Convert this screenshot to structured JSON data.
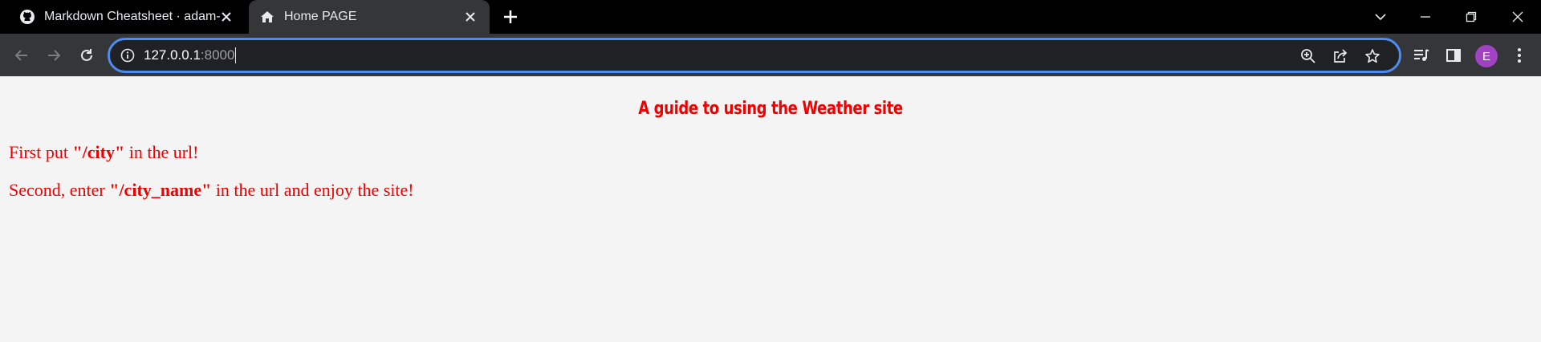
{
  "browser": {
    "tabs": [
      {
        "title": "Markdown Cheatsheet · adam-p/",
        "favicon": "github-icon",
        "active": false
      },
      {
        "title": "Home PAGE",
        "favicon": "home-icon",
        "active": true
      }
    ],
    "address_bar": {
      "host": "127.0.0.1",
      "port": ":8000"
    },
    "profile_initial": "E",
    "colors": {
      "tabstrip": "#000000",
      "toolbar": "#35363a",
      "omnibox_border": "#4f8cf0",
      "avatar": "#a142c2"
    }
  },
  "page": {
    "heading": "A guide to using the Weather site",
    "line1": {
      "prefix": "First put ",
      "code": "\"/city\"",
      "suffix": " in the url!"
    },
    "line2": {
      "prefix": "Second, enter ",
      "code": "\"/city_name\"",
      "suffix": " in the url and enjoy the site!"
    },
    "colors": {
      "text": "#ee0000",
      "background": "#f4f4f4"
    }
  }
}
